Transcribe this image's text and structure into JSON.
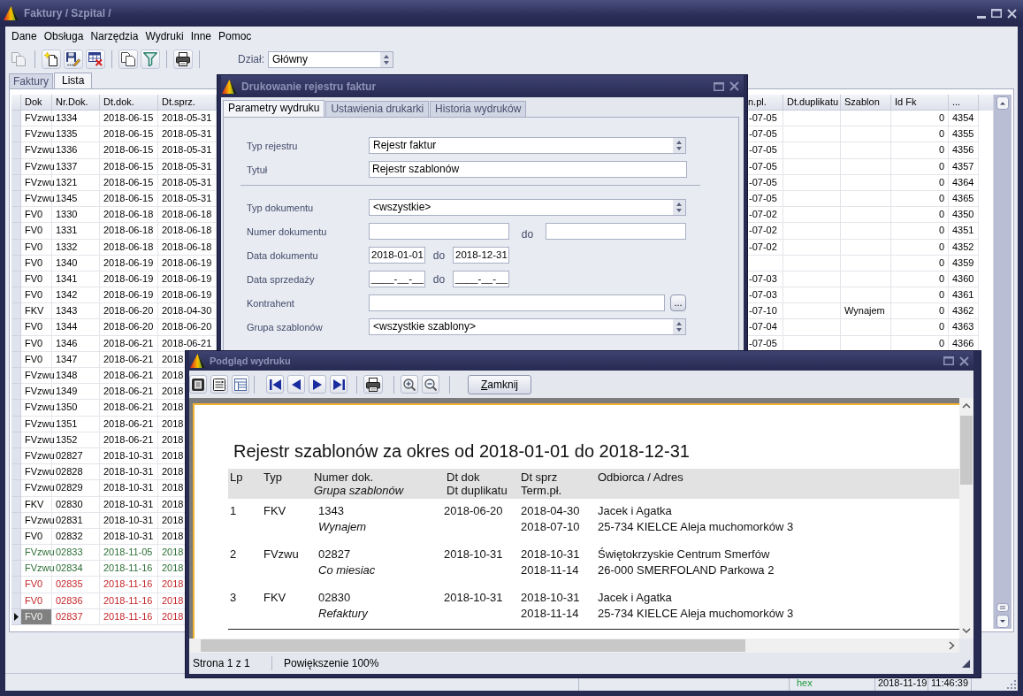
{
  "window": {
    "title": "Faktury / Szpital /"
  },
  "menu": [
    "Dane",
    "Obsługa",
    "Narzędzia",
    "Wydruki",
    "Inne",
    "Pomoc"
  ],
  "toolbar": {
    "buttons": [
      {
        "disabled": true
      },
      {
        "disabled": false
      },
      {
        "disabled": false
      },
      {
        "disabled": false
      },
      {
        "disabled": false
      },
      {
        "disabled": false
      },
      {
        "disabled": false
      }
    ],
    "department_label": "Dział:",
    "department": "Główny"
  },
  "tabs": [
    {
      "label": "Faktury",
      "selected": false
    },
    {
      "label": "Lista",
      "selected": true
    }
  ],
  "grid": {
    "columns": [
      "Dok",
      "Nr.Dok.",
      "Dt.dok.",
      "Dt.sprz.",
      "n.pl.",
      "Dt.duplikatu",
      "Szablon",
      "Id Fk",
      "..."
    ],
    "rows": [
      {
        "cells": [
          "FVzwu",
          "1334",
          "2018-06-15",
          "2018-05-31",
          "-07-05",
          null,
          null,
          "0",
          "4354"
        ],
        "color": "#000000",
        "selected": false
      },
      {
        "cells": [
          "FVzwu",
          "1335",
          "2018-06-15",
          "2018-05-31",
          "-07-05",
          null,
          null,
          "0",
          "4355"
        ],
        "color": "#000000",
        "selected": false
      },
      {
        "cells": [
          "FVzwu",
          "1336",
          "2018-06-15",
          "2018-05-31",
          "-07-05",
          null,
          null,
          "0",
          "4356"
        ],
        "color": "#000000",
        "selected": false
      },
      {
        "cells": [
          "FVzwu",
          "1337",
          "2018-06-15",
          "2018-05-31",
          "-07-05",
          null,
          null,
          "0",
          "4357"
        ],
        "color": "#000000",
        "selected": false
      },
      {
        "cells": [
          "FVzwu",
          "1321",
          "2018-06-15",
          "2018-05-31",
          "-07-05",
          null,
          null,
          "0",
          "4364"
        ],
        "color": "#000000",
        "selected": false
      },
      {
        "cells": [
          "FVzwu",
          "1345",
          "2018-06-15",
          "2018-05-31",
          "-07-05",
          null,
          null,
          "0",
          "4365"
        ],
        "color": "#000000",
        "selected": false
      },
      {
        "cells": [
          "FV0",
          "1330",
          "2018-06-18",
          "2018-06-18",
          "-07-02",
          null,
          null,
          "0",
          "4350"
        ],
        "color": "#000000",
        "selected": false
      },
      {
        "cells": [
          "FV0",
          "1331",
          "2018-06-18",
          "2018-06-18",
          "-07-02",
          null,
          null,
          "0",
          "4351"
        ],
        "color": "#000000",
        "selected": false
      },
      {
        "cells": [
          "FV0",
          "1332",
          "2018-06-18",
          "2018-06-18",
          "-07-02",
          null,
          null,
          "0",
          "4352"
        ],
        "color": "#000000",
        "selected": false
      },
      {
        "cells": [
          "FV0",
          "1340",
          "2018-06-19",
          "2018-06-19",
          null,
          null,
          null,
          "0",
          "4359"
        ],
        "color": "#000000",
        "selected": false
      },
      {
        "cells": [
          "FV0",
          "1341",
          "2018-06-19",
          "2018-06-19",
          "-07-03",
          null,
          null,
          "0",
          "4360"
        ],
        "color": "#000000",
        "selected": false
      },
      {
        "cells": [
          "FV0",
          "1342",
          "2018-06-19",
          "2018-06-19",
          "-07-03",
          null,
          null,
          "0",
          "4361"
        ],
        "color": "#000000",
        "selected": false
      },
      {
        "cells": [
          "FKV",
          "1343",
          "2018-06-20",
          "2018-04-30",
          "-07-10",
          null,
          "Wynajem",
          "0",
          "4362"
        ],
        "color": "#000000",
        "selected": false
      },
      {
        "cells": [
          "FV0",
          "1344",
          "2018-06-20",
          "2018-06-20",
          "-07-04",
          null,
          null,
          "0",
          "4363"
        ],
        "color": "#000000",
        "selected": false
      },
      {
        "cells": [
          "FV0",
          "1346",
          "2018-06-21",
          "2018-06-21",
          "-07-05",
          null,
          null,
          "0",
          "4366"
        ],
        "color": "#000000",
        "selected": false
      },
      {
        "cells": [
          "FV0",
          "1347",
          "2018-06-21",
          "2018"
        ],
        "color": "#000000",
        "selected": false
      },
      {
        "cells": [
          "FVzwu",
          "1348",
          "2018-06-21",
          "2018"
        ],
        "color": "#000000",
        "selected": false
      },
      {
        "cells": [
          "FVzwu",
          "1349",
          "2018-06-21",
          "2018"
        ],
        "color": "#000000",
        "selected": false
      },
      {
        "cells": [
          "FVzwu",
          "1350",
          "2018-06-21",
          "2018"
        ],
        "color": "#000000",
        "selected": false
      },
      {
        "cells": [
          "FVzwu",
          "1351",
          "2018-06-21",
          "2018"
        ],
        "color": "#000000",
        "selected": false
      },
      {
        "cells": [
          "FVzwu",
          "1352",
          "2018-06-21",
          "2018"
        ],
        "color": "#000000",
        "selected": false
      },
      {
        "cells": [
          "FVzwu",
          "02827",
          "2018-10-31",
          "2018"
        ],
        "color": "#000000",
        "selected": false
      },
      {
        "cells": [
          "FVzwu",
          "02828",
          "2018-10-31",
          "2018"
        ],
        "color": "#000000",
        "selected": false
      },
      {
        "cells": [
          "FVzwu",
          "02829",
          "2018-10-31",
          "2018"
        ],
        "color": "#000000",
        "selected": false
      },
      {
        "cells": [
          "FKV",
          "02830",
          "2018-10-31",
          "2018"
        ],
        "color": "#000000",
        "selected": false
      },
      {
        "cells": [
          "FVzwu",
          "02831",
          "2018-10-31",
          "2018"
        ],
        "color": "#000000",
        "selected": false
      },
      {
        "cells": [
          "FV0",
          "02832",
          "2018-10-31",
          "2018"
        ],
        "color": "#000000",
        "selected": false
      },
      {
        "cells": [
          "FVzwu",
          "02833",
          "2018-11-05",
          "2018"
        ],
        "color": "#2c6e35",
        "selected": false
      },
      {
        "cells": [
          "FVzwu",
          "02834",
          "2018-11-16",
          "2018"
        ],
        "color": "#2c6e35",
        "selected": false
      },
      {
        "cells": [
          "FV0",
          "02835",
          "2018-11-16",
          "2018"
        ],
        "color": "#c4262a",
        "selected": false
      },
      {
        "cells": [
          "FV0",
          "02836",
          "2018-11-16",
          "2018"
        ],
        "color": "#c4262a",
        "selected": false
      },
      {
        "cells": [
          "FV0",
          "02837",
          "2018-11-16",
          "2018"
        ],
        "color": "#c4262a",
        "selected": true
      }
    ]
  },
  "print_dialog": {
    "title": "Drukowanie rejestru faktur",
    "tabs": [
      {
        "label": "Parametry wydruku",
        "selected": true
      },
      {
        "label": "Ustawienia drukarki",
        "selected": false
      },
      {
        "label": "Historia wydruków",
        "selected": false
      }
    ],
    "fields": [
      {
        "kind": "select",
        "label": "Typ rejestru",
        "value": "Rejestr faktur"
      },
      {
        "kind": "text",
        "label": "Tytuł",
        "value": "Rejestr szablonów"
      },
      {
        "kind": "divider"
      },
      {
        "kind": "select",
        "label": "Typ dokumentu",
        "value": "<wszystkie>"
      },
      {
        "kind": "number_range",
        "label": "Numer dokumentu",
        "joiner": "do"
      },
      {
        "kind": "date_range",
        "label": "Data dokumentu",
        "from": "2018-01-01",
        "joiner": "do",
        "to": "2018-12-31"
      },
      {
        "kind": "date_range",
        "label": "Data sprzedaży",
        "from": "____-__-__",
        "joiner": "do",
        "to": "____-__-__"
      },
      {
        "kind": "lookup",
        "label": "Kontrahent",
        "button": "..."
      },
      {
        "kind": "select",
        "label": "Grupa szablonów",
        "value": "<wszystkie szablony>"
      }
    ]
  },
  "preview": {
    "title": "Podgląd wydruku",
    "close_button": "Zamknij",
    "report": {
      "title": "Rejestr szablonów za okres od 2018-01-01 do 2018-12-31",
      "columns": [
        {
          "label": "Lp"
        },
        {
          "label": "Typ"
        },
        {
          "label": "Numer dok.",
          "sub": "Grupa szablonów",
          "sub_italic": true
        },
        {
          "label": "Dt dok",
          "sub": "Dt duplikatu",
          "sub_italic": false
        },
        {
          "label": "Dt sprz",
          "sub": "Term.pł.",
          "sub_italic": false
        },
        {
          "label": "Odbiorca / Adres"
        }
      ],
      "rows": [
        {
          "lp": "1",
          "type": "FKV",
          "number": "1343",
          "group": "Wynajem",
          "doc_date": "2018-06-20",
          "sale_date": "2018-04-30",
          "due_date": "2018-07-10",
          "recipient": "Jacek i Agatka",
          "address": "25-734 KIELCE Aleja muchomorków 3"
        },
        {
          "lp": "2",
          "type": "FVzwu",
          "number": "02827",
          "group": "Co miesiac",
          "doc_date": "2018-10-31",
          "sale_date": "2018-10-31",
          "due_date": "2018-11-14",
          "recipient": "Świętokrzyskie Centrum Smerfów",
          "address": "26-000 SMERFOLAND Parkowa 2"
        },
        {
          "lp": "3",
          "type": "FKV",
          "number": "02830",
          "group": "Refaktury",
          "doc_date": "2018-10-31",
          "sale_date": "2018-10-31",
          "due_date": "2018-11-14",
          "recipient": "Jacek i Agatka",
          "address": "25-734 KIELCE Aleja muchomorków 3"
        }
      ]
    },
    "status": {
      "page": "Strona 1 z 1",
      "zoom": "Powiększenie 100%"
    }
  },
  "status_bar": {
    "mode": "hex",
    "date": "2018-11-19",
    "time": "11:46:39"
  }
}
